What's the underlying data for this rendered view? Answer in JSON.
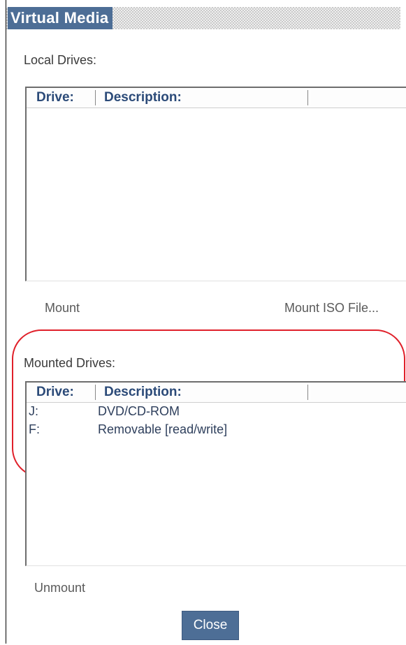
{
  "window": {
    "title": "Virtual Media"
  },
  "local_drives": {
    "label": "Local Drives:",
    "columns": [
      "Drive:",
      "Description:"
    ],
    "rows": []
  },
  "mount_button": "Mount",
  "mount_iso_button": "Mount ISO File...",
  "mounted_drives": {
    "label": "Mounted Drives:",
    "columns": [
      "Drive:",
      "Description:"
    ],
    "rows": [
      {
        "drive": "J:",
        "description": "DVD/CD-ROM"
      },
      {
        "drive": "F:",
        "description": "Removable [read/write]"
      }
    ]
  },
  "unmount_button": "Unmount",
  "close_button": "Close",
  "colors": {
    "title_bar": "#4d6e96",
    "header_text": "#2b4a78",
    "highlight": "#e0202a"
  }
}
